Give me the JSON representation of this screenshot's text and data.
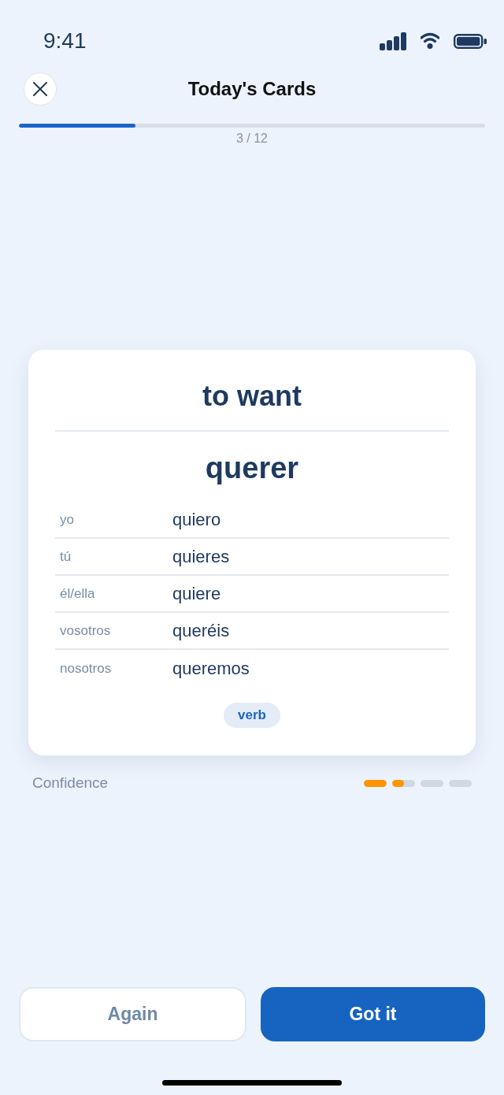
{
  "status_bar": {
    "time": "9:41"
  },
  "header": {
    "title": "Today's Cards",
    "progress": {
      "level": 0.25,
      "counter": "3 / 12"
    }
  },
  "card": {
    "translation": "to want",
    "word": "querer",
    "conjugations": [
      {
        "pronoun": "yo",
        "form": "quiero"
      },
      {
        "pronoun": "tú",
        "form": "quieres"
      },
      {
        "pronoun": "él/ella",
        "form": "quiere"
      },
      {
        "pronoun": "vosotros",
        "form": "queréis"
      },
      {
        "pronoun": "nosotros",
        "form": "queremos"
      }
    ],
    "tag": "verb"
  },
  "confidence": {
    "label": "Confidence",
    "segments": [
      {
        "level": 1
      },
      {
        "level": 0.5
      },
      {
        "level": 0
      },
      {
        "level": 0
      }
    ]
  },
  "actions": [
    {
      "label": "Again",
      "kind": "secondary"
    },
    {
      "label": "Got it",
      "kind": "primary"
    }
  ]
}
